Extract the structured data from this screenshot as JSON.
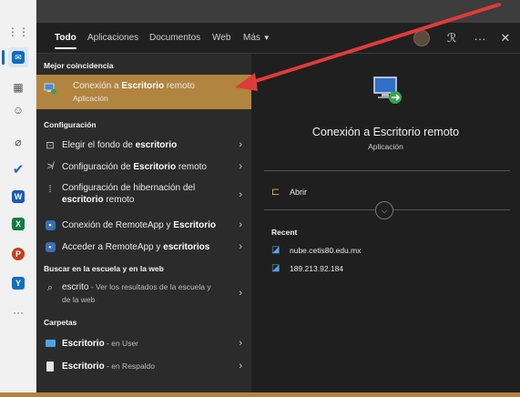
{
  "tabs": [
    "Todo",
    "Aplicaciones",
    "Documentos",
    "Web",
    "Más"
  ],
  "best_match": {
    "heading": "Mejor coincidencia",
    "title_pre": "Conexión a ",
    "title_bold": "Escritorio",
    "title_post": " remoto",
    "subtitle": "Aplicación"
  },
  "settings": {
    "heading": "Configuración",
    "items": [
      {
        "pre": "Elegir el fondo de ",
        "bold": "escritorio",
        "post": ""
      },
      {
        "pre": "Configuración de ",
        "bold": "Escritorio",
        "post": " remoto"
      },
      {
        "pre": "Configuración de hibernación del",
        "line2_bold": "escritorio",
        "line2_post": " remoto"
      },
      {
        "pre": "Conexión de RemoteApp y ",
        "bold": "Escritorio",
        "post": ""
      },
      {
        "pre": "Acceder a RemoteApp y ",
        "bold": "escritorios",
        "post": ""
      }
    ]
  },
  "web": {
    "heading": "Buscar en la escuela y en la web",
    "term": "escrito",
    "suffix": " - Ver los resultados de la escuela y",
    "suffix2": "de la web"
  },
  "folders": {
    "heading": "Carpetas",
    "items": [
      {
        "name": "Escritorio",
        "location": " - en User"
      },
      {
        "name": "Escritorio",
        "location": " - en Respaldo"
      }
    ]
  },
  "detail": {
    "title": "Conexión a Escritorio remoto",
    "subtitle": "Aplicación",
    "open_label": "Abrir",
    "recent_heading": "Recent",
    "recent": [
      "nube.cetis80.edu.mx",
      "189.213.92.184"
    ]
  }
}
